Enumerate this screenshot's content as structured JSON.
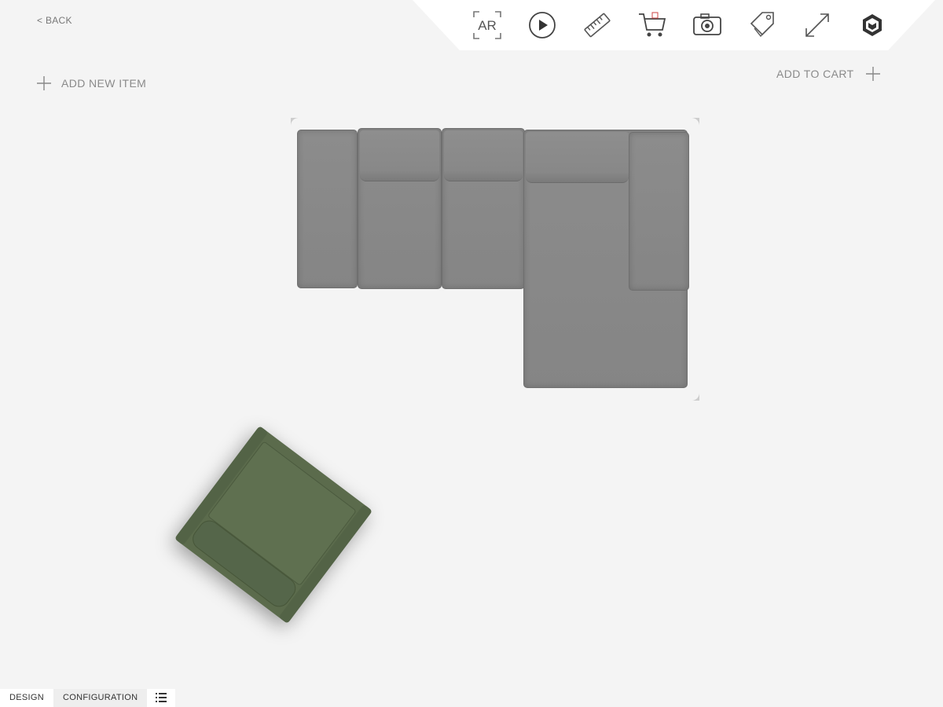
{
  "nav": {
    "back_label": "< BACK"
  },
  "toolbar": {
    "ar_label": "AR",
    "buttons": [
      {
        "name": "ar-icon"
      },
      {
        "name": "play-icon"
      },
      {
        "name": "ruler-icon"
      },
      {
        "name": "cart-icon"
      },
      {
        "name": "camera-icon"
      },
      {
        "name": "tag-icon"
      },
      {
        "name": "expand-icon"
      },
      {
        "name": "brand-logo-icon"
      }
    ]
  },
  "actions": {
    "add_new_item": "ADD NEW ITEM",
    "add_to_cart": "ADD TO CART"
  },
  "tabs": {
    "design": "DESIGN",
    "configuration": "CONFIGURATION",
    "list_icon": "list-icon"
  },
  "colors": {
    "sofa": "#8a8a8a",
    "armchair": "#5b6b4c",
    "background": "#f4f4f4"
  }
}
